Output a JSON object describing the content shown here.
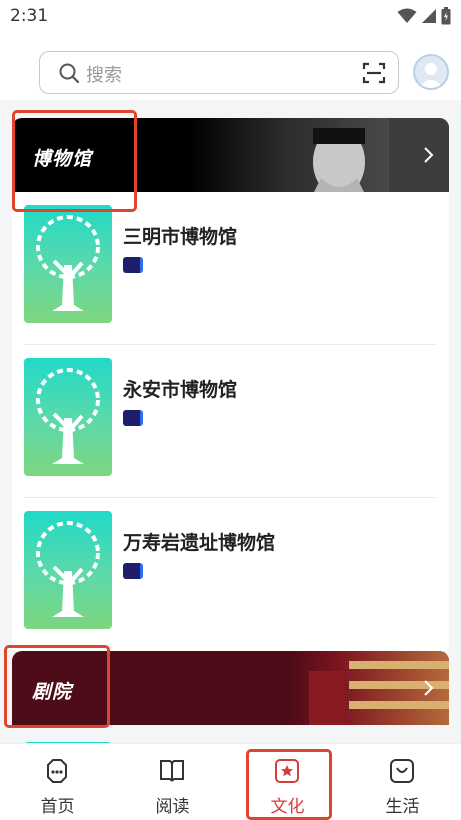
{
  "status_bar": {
    "time": "2:31",
    "icons": [
      "wifi-icon",
      "signal-icon",
      "battery-icon"
    ]
  },
  "search": {
    "placeholder": "搜索",
    "icons": [
      "search-icon",
      "scan-icon"
    ]
  },
  "sections": [
    {
      "title": "博物馆",
      "items": [
        {
          "name": "三明市博物馆"
        },
        {
          "name": "永安市博物馆"
        },
        {
          "name": "万寿岩遗址博物馆"
        }
      ]
    },
    {
      "title": "剧院"
    }
  ],
  "bottom_nav": {
    "items": [
      {
        "label": "首页",
        "icon": "chat-face-icon"
      },
      {
        "label": "阅读",
        "icon": "book-icon"
      },
      {
        "label": "文化",
        "icon": "star-icon"
      },
      {
        "label": "生活",
        "icon": "bag-icon"
      }
    ],
    "active_index": 2
  },
  "colors": {
    "accent": "#d83b3b",
    "highlight": "#e0442c",
    "thumb_top": "#21d9c8",
    "thumb_bottom": "#7ed67f",
    "theatre_banner": "#4d0c17"
  }
}
